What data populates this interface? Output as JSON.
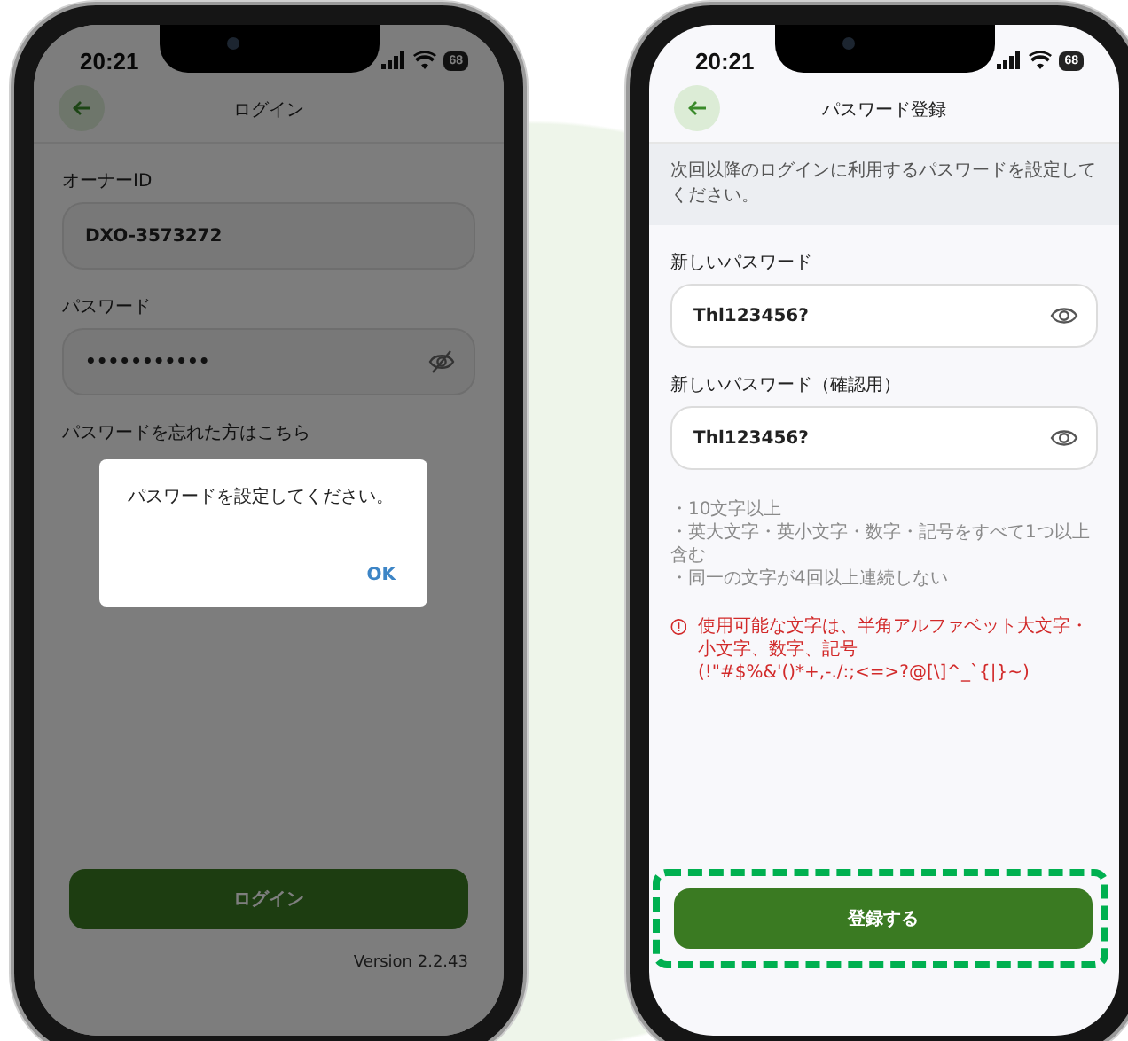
{
  "phones": [
    {
      "kind": "login",
      "status": {
        "time": "20:21",
        "battery": "68"
      },
      "header": {
        "title": "ログイン"
      },
      "fields": [
        {
          "label": "オーナーID",
          "value": "DXO-3573272"
        },
        {
          "label": "パスワード",
          "value": "•••••••••••",
          "masked": true
        }
      ],
      "link": "パスワードを忘れた方はこちら",
      "button": {
        "label": "ログイン",
        "highlighted": false
      },
      "version": "Version 2.2.43",
      "dialog": {
        "message": "パスワードを設定してください。",
        "button": "OK"
      }
    },
    {
      "kind": "register",
      "status": {
        "time": "20:21",
        "battery": "68"
      },
      "header": {
        "title": "パスワード登録"
      },
      "notice": "次回以降のログインに利用するパスワードを設定してください。",
      "fields": [
        {
          "label": "新しいパスワード",
          "value": "Thl123456?",
          "masked": false
        },
        {
          "label": "新しいパスワード（確認用）",
          "value": "Thl123456?",
          "masked": false
        }
      ],
      "rules": [
        "・10文字以上",
        "・英大文字・英小文字・数字・記号をすべて1つ以上含む",
        "・同一の文字が4回以上連続しない"
      ],
      "error": {
        "message": "使用可能な文字は、半角アルファベット大文字・小文字、数字、記号",
        "symbols": "(!\"#$%&'()*+,-./:;<=>?@[\\]^_`{|}~)"
      },
      "button": {
        "label": "登録する",
        "highlighted": true
      }
    }
  ]
}
